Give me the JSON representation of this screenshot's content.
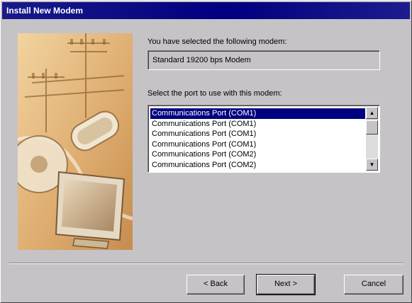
{
  "window": {
    "title": "Install New Modem"
  },
  "modem_section": {
    "label": "You have selected the following modem:",
    "value": "Standard 19200 bps Modem"
  },
  "port_section": {
    "label": "Select the port to use with this modem:",
    "items": [
      "Communications Port (COM1)",
      "Communications Port (COM1)",
      "Communications Port (COM1)",
      "Communications Port (COM1)",
      "Communications Port (COM2)",
      "Communications Port (COM2)"
    ],
    "selected_index": 0
  },
  "buttons": {
    "back": "< Back",
    "next": "Next >",
    "cancel": "Cancel"
  },
  "scrollbar": {
    "up_icon": "triangle-up",
    "down_icon": "triangle-down"
  },
  "colors": {
    "title_bar": "#000080",
    "selection": "#000080",
    "dialog_face": "#c6c3c6"
  }
}
